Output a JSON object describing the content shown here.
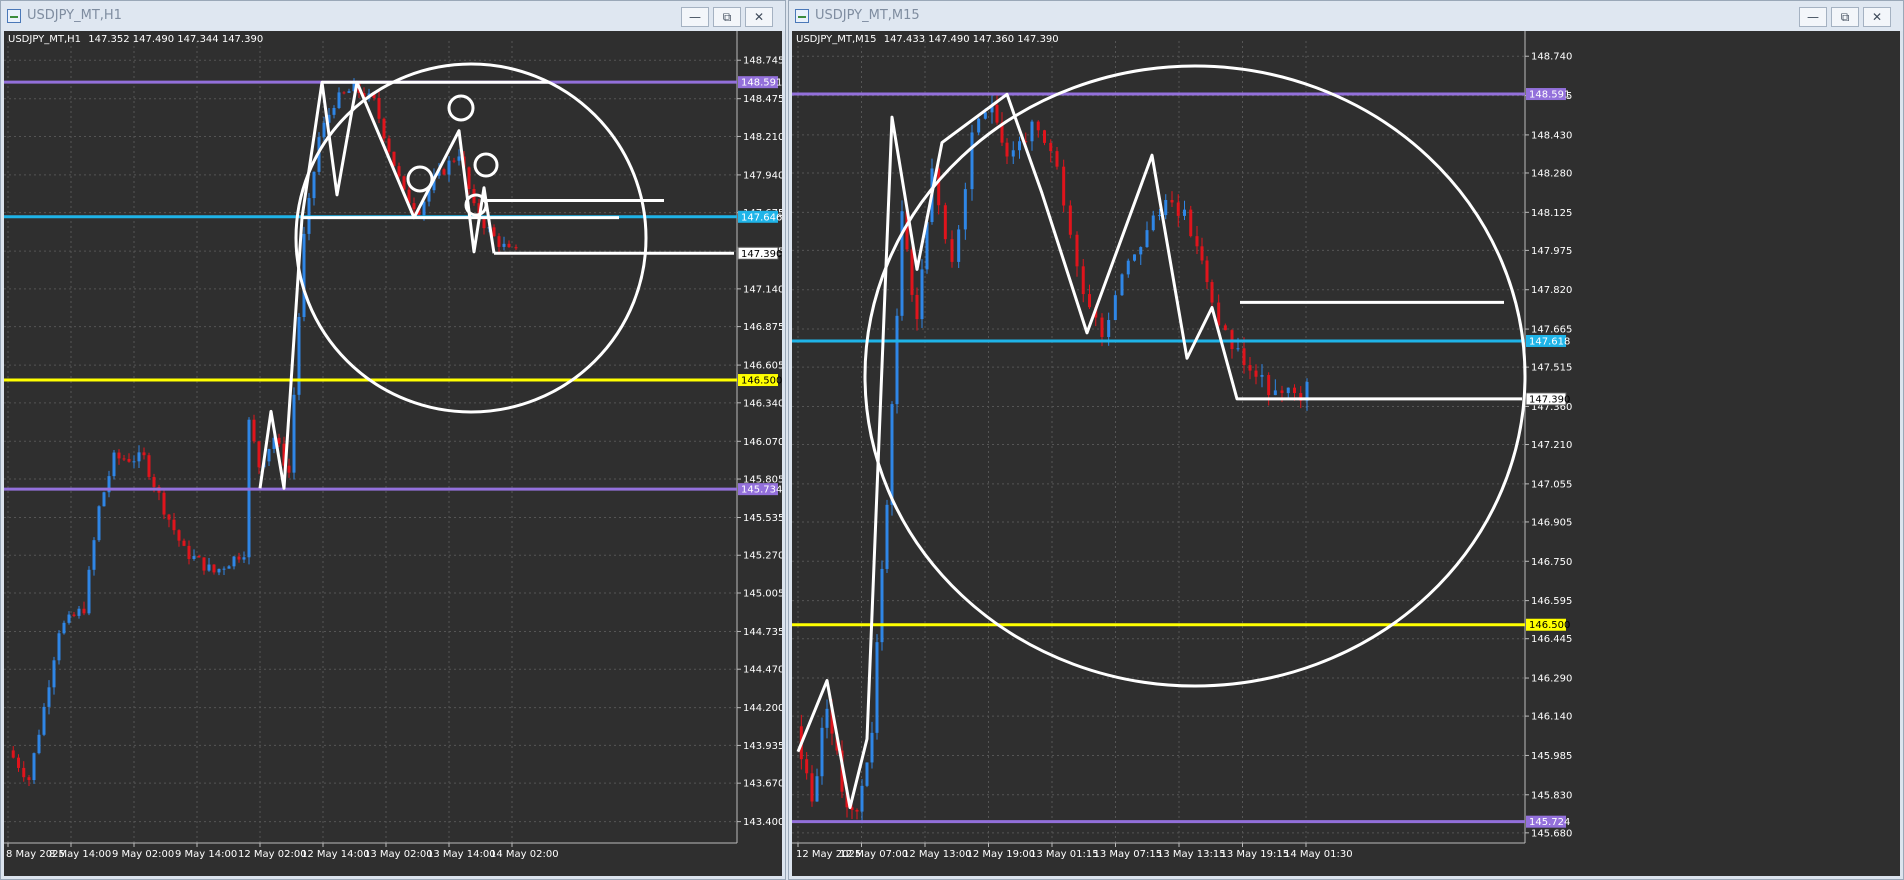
{
  "windows": [
    {
      "id": "h1",
      "title": "USDJPY_MT,H1",
      "header_symbol": "USDJPY_MT,H1",
      "header_ohlc": "147.352 147.490 147.344 147.390",
      "buttons": {
        "minimize": "—",
        "restore": "⧉",
        "close": "✕"
      },
      "chart_data": {
        "type": "candlestick",
        "price_range": [
          143.25,
          148.88
        ],
        "y_ticks": [
          "148.745",
          "148.475",
          "148.210",
          "147.940",
          "147.675",
          "147.405",
          "147.140",
          "146.875",
          "146.605",
          "146.340",
          "146.070",
          "145.805",
          "145.535",
          "145.270",
          "145.005",
          "144.735",
          "144.470",
          "144.200",
          "143.935",
          "143.670",
          "143.400"
        ],
        "x_labels": [
          "8 May 2025",
          "8 May 14:00",
          "9 May 02:00",
          "9 May 14:00",
          "12 May 02:00",
          "12 May 14:00",
          "13 May 02:00",
          "13 May 14:00",
          "14 May 02:00"
        ],
        "levels": [
          {
            "price": 148.591,
            "label": "148.591",
            "color": "#9370db"
          },
          {
            "price": 147.646,
            "label": "147.646",
            "color": "#1fb4e8"
          },
          {
            "price": 147.39,
            "label": "147.390",
            "color": "#ffffff"
          },
          {
            "price": 146.5,
            "label": "146.500",
            "color": "#ffff00"
          },
          {
            "price": 145.734,
            "label": "145.734",
            "color": "#9370db"
          }
        ]
      }
    },
    {
      "id": "m15",
      "title": "USDJPY_MT,M15",
      "header_symbol": "USDJPY_MT,M15",
      "header_ohlc": "147.433 147.490 147.360 147.390",
      "buttons": {
        "minimize": "—",
        "restore": "⧉",
        "close": "✕"
      },
      "chart_data": {
        "type": "candlestick",
        "price_range": [
          145.64,
          148.8
        ],
        "y_ticks": [
          "148.740",
          "148.585",
          "148.430",
          "148.280",
          "148.125",
          "147.975",
          "147.820",
          "147.665",
          "147.515",
          "147.360",
          "147.210",
          "147.055",
          "146.905",
          "146.750",
          "146.595",
          "146.445",
          "146.290",
          "146.140",
          "145.985",
          "145.830",
          "145.680"
        ],
        "x_labels": [
          "12 May 2025",
          "12 May 07:00",
          "12 May 13:00",
          "12 May 19:00",
          "13 May 01:15",
          "13 May 07:15",
          "13 May 13:15",
          "13 May 19:15",
          "14 May 01:30"
        ],
        "levels": [
          {
            "price": 148.591,
            "label": "148.591",
            "color": "#9370db"
          },
          {
            "price": 147.618,
            "label": "147.618",
            "color": "#1fb4e8"
          },
          {
            "price": 147.39,
            "label": "147.390",
            "color": "#ffffff"
          },
          {
            "price": 146.5,
            "label": "146.500",
            "color": "#ffff00"
          },
          {
            "price": 145.724,
            "label": "145.724",
            "color": "#9370db"
          }
        ]
      }
    }
  ],
  "colors": {
    "background": "#2f2f2f",
    "grid": "#555555",
    "bull": "#2f86e6",
    "bear": "#e0141c",
    "drawing": "#ffffff"
  }
}
